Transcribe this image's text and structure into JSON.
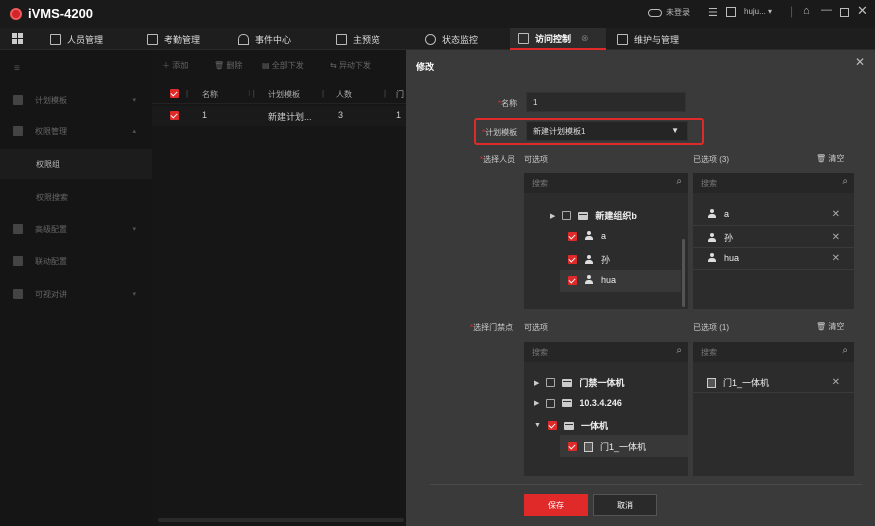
{
  "app": {
    "title": "iVMS-4200"
  },
  "titlebar": {
    "login_status": "未登录",
    "user": "huju..."
  },
  "menu": {
    "items": [
      "人员管理",
      "考勤管理",
      "事件中心",
      "主预览",
      "状态监控",
      "访问控制",
      "维护与管理"
    ],
    "active": "访问控制"
  },
  "sidebar": {
    "items": [
      {
        "label": "计划模板"
      },
      {
        "label": "权限管理"
      },
      {
        "label": "权限组"
      },
      {
        "label": "权限搜索"
      },
      {
        "label": "高级配置"
      },
      {
        "label": "联动配置"
      },
      {
        "label": "可视对讲"
      }
    ]
  },
  "toolbar": {
    "add": "添加",
    "delete": "删除",
    "deliver_all": "全部下发",
    "deliver_error": "异动下发"
  },
  "list": {
    "headers": [
      "名称",
      "计划模板",
      "人数",
      "门"
    ],
    "rows": [
      {
        "index": "1",
        "template": "新建计划...",
        "count": "3",
        "door": "1"
      }
    ]
  },
  "modal": {
    "title": "修改",
    "name_label": "名称",
    "name_value": "1",
    "template_label": "计划模板",
    "template_value": "新建计划模板1",
    "person_label": "选择人员",
    "available_label": "可选项",
    "selected_persons_label": "已选项 (3)",
    "clear_label": "清空",
    "search_placeholder": "搜索",
    "person_tree": [
      {
        "label": "新建组织b",
        "type": "org",
        "checked": false
      },
      {
        "label": "a",
        "type": "person",
        "checked": true
      },
      {
        "label": "孙",
        "type": "person",
        "checked": true
      },
      {
        "label": "hua",
        "type": "person",
        "checked": true
      }
    ],
    "selected_persons": [
      "a",
      "孙",
      "hua"
    ],
    "door_label": "选择门禁点",
    "door_available_label": "可选项",
    "selected_doors_label": "已选项 (1)",
    "door_tree": [
      {
        "label": "门禁一体机",
        "type": "device",
        "checked": false
      },
      {
        "label": "10.3.4.246",
        "type": "device",
        "checked": false
      },
      {
        "label": "一体机",
        "type": "device",
        "checked": true
      },
      {
        "label": "门1_一体机",
        "type": "door",
        "checked": true
      }
    ],
    "selected_doors": [
      "门1_一体机"
    ],
    "save_label": "保存",
    "cancel_label": "取消"
  },
  "colors": {
    "accent_red": "#e02a2a",
    "modal_bg": "#3a3a3a",
    "panel_bg": "#2c2c2c"
  }
}
